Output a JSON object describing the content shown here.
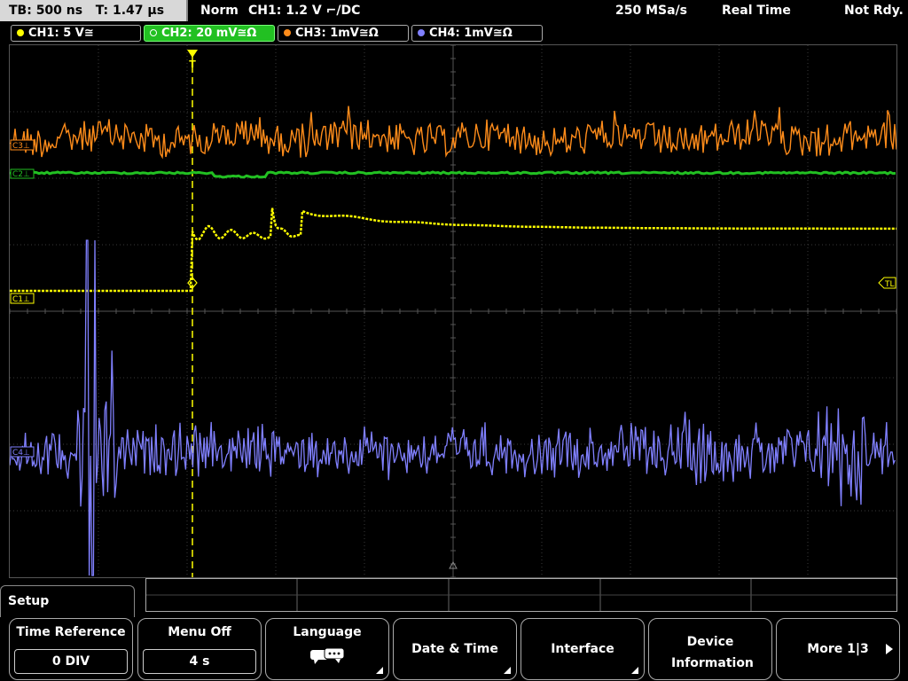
{
  "status_bar": {
    "timebase": "TB: 500 ns",
    "trigger_time": "T: 1.47 µs",
    "trigger_mode": "Norm",
    "trigger_level": "CH1: 1.2 V",
    "trigger_coupling": "DC",
    "sample_rate": "250 MSa/s",
    "acquisition_mode": "Real Time",
    "state": "Not Rdy."
  },
  "channels": [
    {
      "label": "CH1: 5 V≅",
      "color": "#ffff00",
      "active": false
    },
    {
      "label": "CH2: 20 mV≅Ω",
      "color": "#22c022",
      "active": true
    },
    {
      "label": "CH3: 1mV≅Ω",
      "color": "#ff8c1a",
      "active": false
    },
    {
      "label": "CH4: 1mV≅Ω",
      "color": "#8080ff",
      "active": false
    }
  ],
  "markers": {
    "c3": "C3⊥",
    "c2": "C2⊥",
    "c1": "C1⊥",
    "c4": "C4⊥",
    "trigger_level": "TL",
    "trigger_pos": "T"
  },
  "menu": {
    "title": "Setup",
    "softkeys": [
      {
        "title": "Time Reference",
        "value": "0 DIV"
      },
      {
        "title": "Menu Off",
        "value": "4 s"
      },
      {
        "title": "Language",
        "icon": "speech-bubbles-icon"
      },
      {
        "title": "Date & Time"
      },
      {
        "title": "Interface"
      },
      {
        "title": "Device Information"
      },
      {
        "title": "More 1|3",
        "icon": "right-arrow-icon"
      }
    ]
  },
  "colors": {
    "ch1": "#ffff00",
    "ch2": "#22c022",
    "ch3": "#ff8c1a",
    "ch4": "#8080ff",
    "grid": "#3a3a3a",
    "trigger": "#ffff00"
  }
}
